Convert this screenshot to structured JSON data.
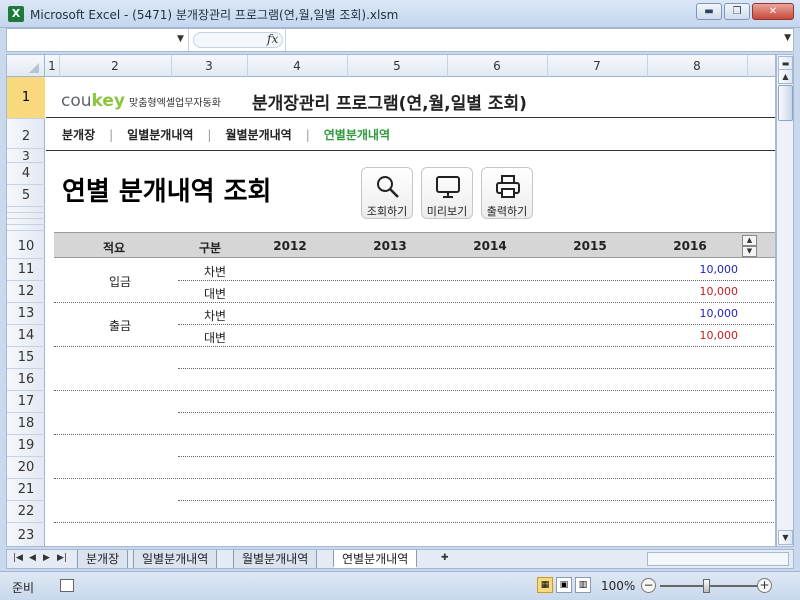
{
  "window": {
    "app_icon": "X",
    "title": "Microsoft Excel - (5471) 분개장관리 프로그램(연,월,일별 조회).xlsm",
    "buttons": {
      "minimize": "▬",
      "maximize": "❐",
      "close": "✕"
    }
  },
  "formula_bar": {
    "name_box": "",
    "fx_label": "fx",
    "formula": ""
  },
  "columns": [
    "1",
    "2",
    "3",
    "4",
    "5",
    "6",
    "7",
    "8"
  ],
  "rows": [
    "1",
    "2",
    "3",
    "4",
    "5",
    "10",
    "11",
    "12",
    "13",
    "14",
    "15",
    "16",
    "17",
    "18",
    "19",
    "20",
    "21",
    "22",
    "23"
  ],
  "brand": {
    "cou": "cou",
    "key": "key",
    "tagline": "맞춤형엑셀업무자동화"
  },
  "app_title": "분개장관리 프로그램(연,월,일별 조회)",
  "nav": [
    {
      "label": "분개장"
    },
    {
      "label": "일별분개내역"
    },
    {
      "label": "월별분개내역"
    },
    {
      "label": "연별분개내역"
    }
  ],
  "page_heading": "연별 분개내역 조회",
  "tool_buttons": {
    "search": "조회하기",
    "preview": "미리보기",
    "print": "출력하기"
  },
  "table": {
    "headers": {
      "summary": "적요",
      "type": "구분",
      "y1": "2012",
      "y2": "2013",
      "y3": "2014",
      "y4": "2015",
      "y5": "2016"
    },
    "groups": [
      {
        "summary": "입금",
        "rows": [
          {
            "type": "차변",
            "y2016": "10,000"
          },
          {
            "type": "대변",
            "y2016": "10,000"
          }
        ]
      },
      {
        "summary": "출금",
        "rows": [
          {
            "type": "차변",
            "y2016": "10,000"
          },
          {
            "type": "대변",
            "y2016": "10,000"
          }
        ]
      }
    ]
  },
  "sheet_tabs": [
    "분개장",
    "일별분개내역",
    "월별분개내역",
    "연별분개내역"
  ],
  "status": {
    "ready": "준비",
    "zoom": "100%"
  }
}
